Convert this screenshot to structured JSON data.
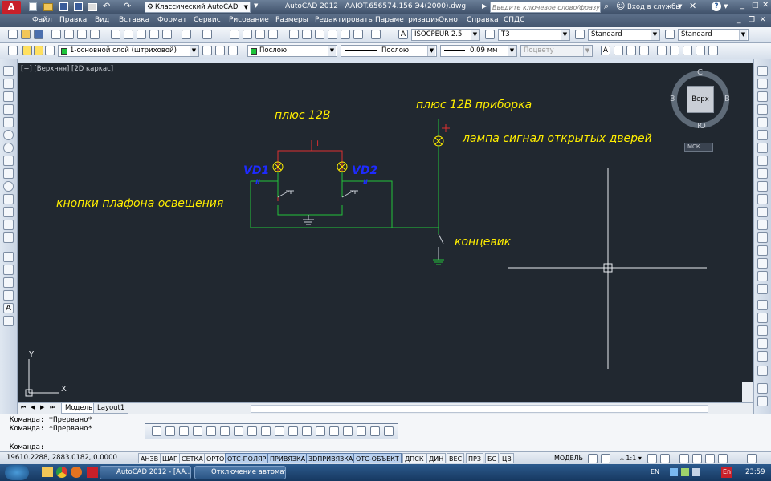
{
  "title_bar": {
    "workspace": "Классический AutoCAD",
    "app_title": "AutoCAD 2012",
    "file_name": "AAIOT.656574.156 Э4(2000).dwg",
    "search_placeholder": "Введите ключевое слово/фразу",
    "signin": "Вход в службы"
  },
  "menu": [
    "Файл",
    "Правка",
    "Вид",
    "Вставка",
    "Формат",
    "Сервис",
    "Рисование",
    "Размеры",
    "Редактировать",
    "Параметризация",
    "Окно",
    "Справка",
    "СПДС"
  ],
  "toolbar2": {
    "textstyle": "ISOCPEUR 2.5",
    "dimstyle": "Т3",
    "tablestyle": "Standard",
    "mleaderstyle": "Standard"
  },
  "toolbar3": {
    "layer": "1-основной слой (штриховой)",
    "color": "Послою",
    "linetype": "Послою",
    "lineweight": "0.09 мм",
    "plotstyle": "Поцвету"
  },
  "viewport_label": "[−] [Верхняя] [2D каркас]",
  "viewcube": {
    "face": "Верх",
    "north": "С",
    "south": "Ю",
    "west": "З",
    "east": "В",
    "wcs": "МСК"
  },
  "drawing": {
    "label_plus12": "плюс 12В",
    "label_plus12_dash": "плюс 12В приборка",
    "label_lamp": "лампа сигнал открытых дверей",
    "label_buttons": "кнопки плафона освещения",
    "label_switch": "концевик",
    "vd1": "VD1",
    "vd2": "VD2",
    "plus_sign": "+",
    "axis_x": "X",
    "axis_y": "Y"
  },
  "tabs": [
    "Модель",
    "Layout1"
  ],
  "command_lines": [
    "Команда:  *Прервано*",
    "Команда:  *Прервано*",
    "Команда:"
  ],
  "status": {
    "coords": "19610.2288, 2883.0182, 0.0000",
    "buttons": [
      {
        "label": "АНЗВ",
        "on": false
      },
      {
        "label": "ШАГ",
        "on": false
      },
      {
        "label": "СЕТКА",
        "on": false
      },
      {
        "label": "ОРТО",
        "on": false
      },
      {
        "label": "ОТС-ПОЛЯР",
        "on": true
      },
      {
        "label": "ПРИВЯЗКА",
        "on": true
      },
      {
        "label": "3DПРИВЯЗКА",
        "on": true
      },
      {
        "label": "ОТС-ОБЪЕКТ",
        "on": true
      },
      {
        "label": "ДПСК",
        "on": false
      },
      {
        "label": "ДИН",
        "on": false
      },
      {
        "label": "ВЕС",
        "on": false
      },
      {
        "label": "ПРЗ",
        "on": false
      },
      {
        "label": "БС",
        "on": false
      },
      {
        "label": "ЦВ",
        "on": false
      }
    ],
    "model": "МОДЕЛЬ",
    "scale": "1:1"
  },
  "taskbar": {
    "tasks": [
      "AutoCAD 2012 - [AA...",
      "Отключение автомат..."
    ],
    "lang": "EN",
    "lang2": "En",
    "time": "23:59"
  },
  "colors": {
    "canvas": "#212830",
    "wire_green": "#22c43a",
    "wire_red": "#e03030",
    "lamp_yellow": "#ffee00",
    "label_blue": "#1e2bff"
  }
}
